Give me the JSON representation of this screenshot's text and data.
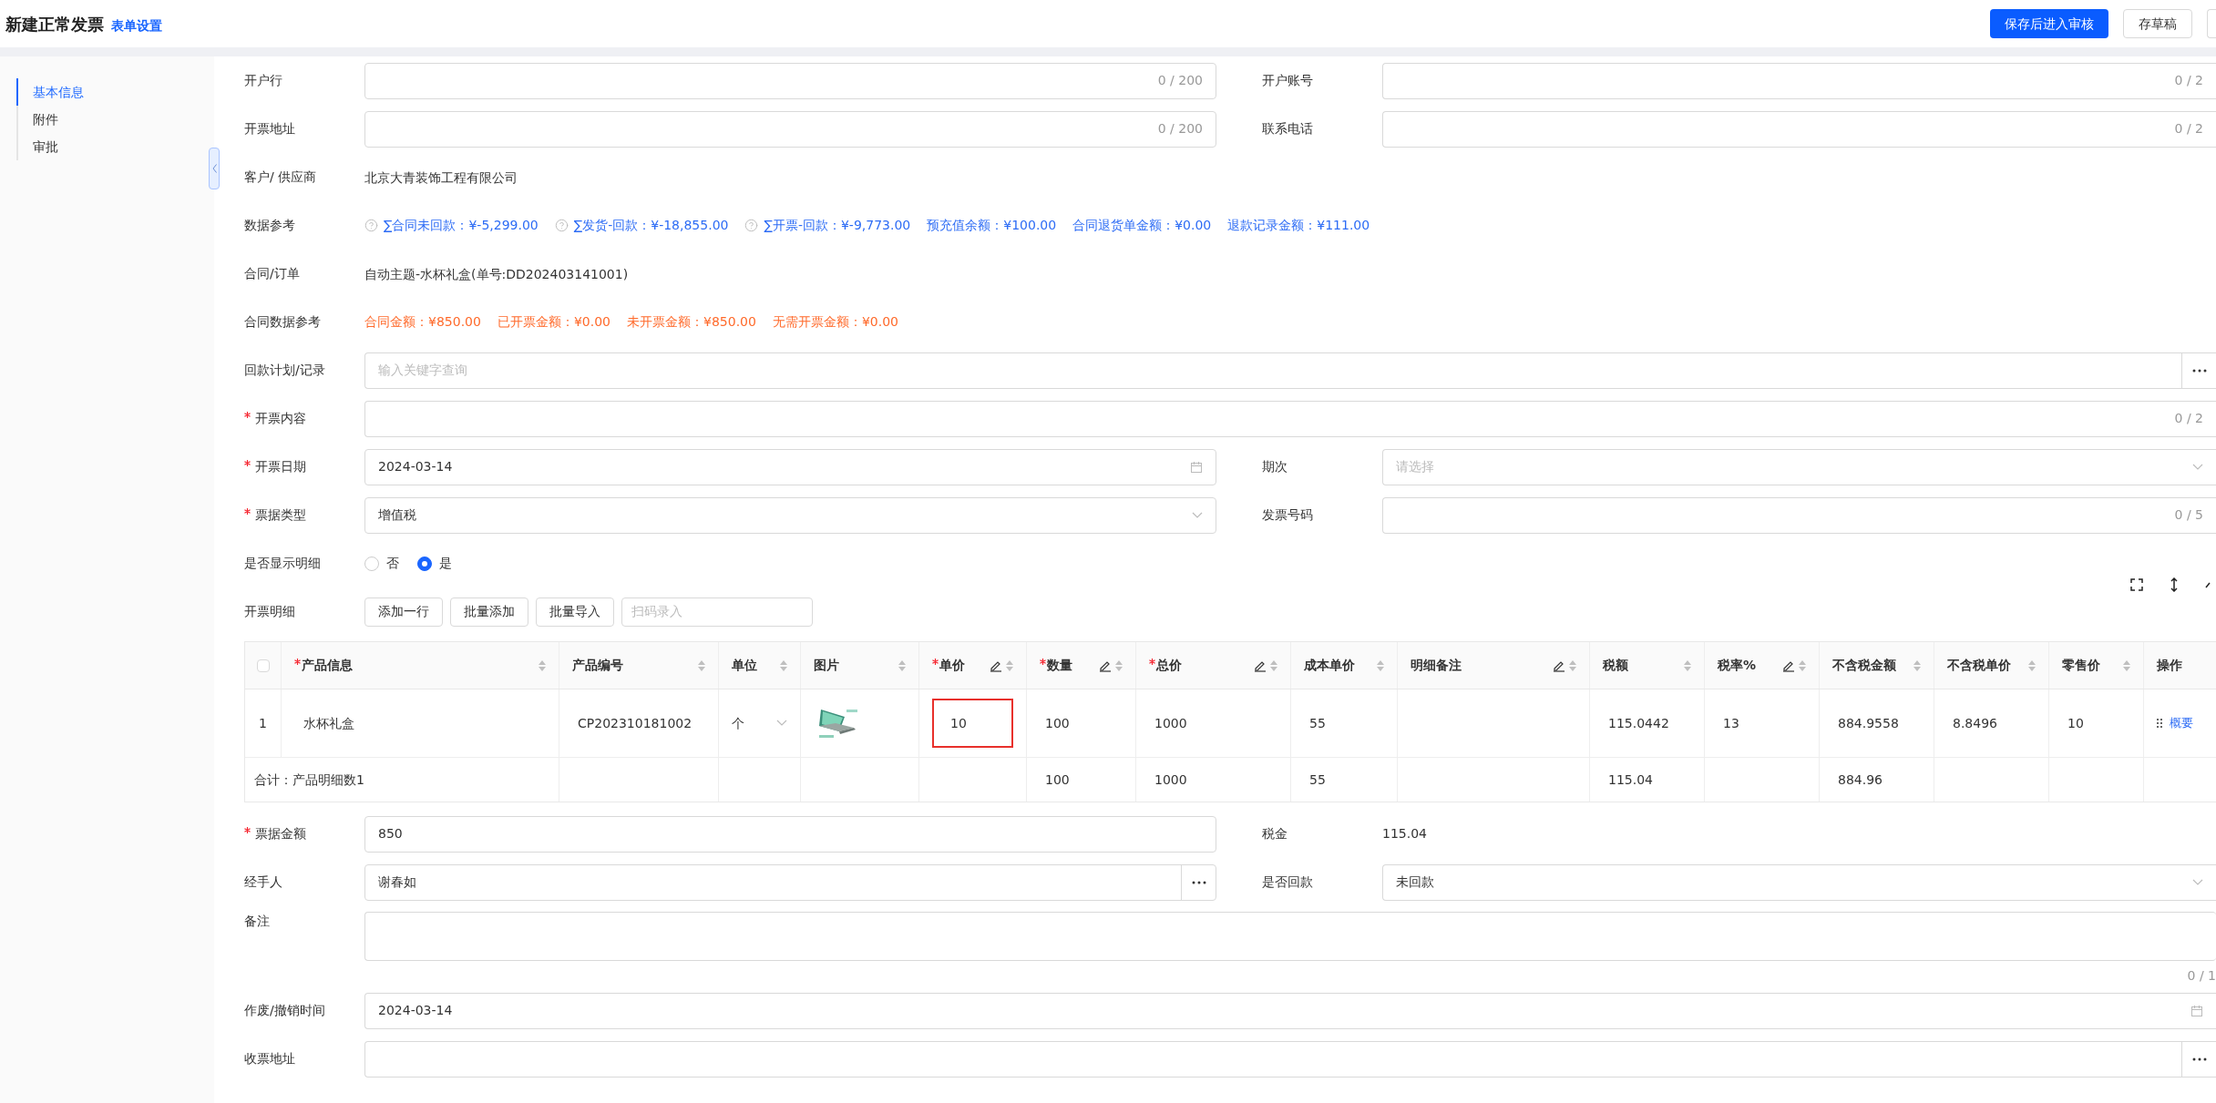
{
  "header": {
    "title": "新建正常发票",
    "link": "表单设置",
    "buttons": [
      {
        "label": "保存后进入审核",
        "kind": "primary"
      },
      {
        "label": "存草稿",
        "kind": "default"
      }
    ]
  },
  "sidebar": {
    "items": [
      {
        "label": "基本信息",
        "selected": true
      },
      {
        "label": "附件",
        "selected": false
      },
      {
        "label": "审批",
        "selected": false
      }
    ]
  },
  "form_top": [
    {
      "left": {
        "label": "开户行",
        "kind": "input",
        "counter": "0 / 200"
      },
      "right": {
        "label": "开户账号",
        "kind": "input",
        "counter": "0 / 2"
      }
    },
    {
      "left": {
        "label": "开票地址",
        "kind": "input",
        "counter": "0 / 200"
      },
      "right": {
        "label": "联系电话",
        "kind": "input",
        "counter": "0 / 2"
      }
    },
    {
      "left": {
        "label": "客户/ 供应商",
        "kind": "text",
        "value": "北京大青装饰工程有限公司"
      }
    },
    {
      "left": {
        "label": "数据参考",
        "kind": "refs",
        "items": [
          {
            "text": "∑合同未回款：¥-5,299.00",
            "help": true,
            "color": "#2d6cf5"
          },
          {
            "text": "∑发货-回款：¥-18,855.00",
            "help": true,
            "color": "#2d6cf5"
          },
          {
            "text": "∑开票-回款：¥-9,773.00",
            "help": true,
            "color": "#2d6cf5"
          },
          {
            "text": "预充值余额：¥100.00",
            "help": false,
            "color": "#2d6cf5"
          },
          {
            "text": "合同退货单金额：¥0.00",
            "help": false,
            "color": "#2d6cf5"
          },
          {
            "text": "退款记录金额：¥111.00",
            "help": false,
            "color": "#2d6cf5"
          }
        ]
      }
    },
    {
      "left": {
        "label": "合同/订单",
        "kind": "text",
        "value": "自动主题-水杯礼盒(单号:DD202403141001)"
      }
    },
    {
      "left": {
        "label": "合同数据参考",
        "kind": "refs",
        "items": [
          {
            "text": "合同金额：¥850.00",
            "help": false,
            "color": "#ff6a2b"
          },
          {
            "text": "已开票金额：¥0.00",
            "help": false,
            "color": "#ff6a2b"
          },
          {
            "text": "未开票金额：¥850.00",
            "help": false,
            "color": "#ff6a2b"
          },
          {
            "text": "无需开票金额：¥0.00",
            "help": false,
            "color": "#ff6a2b"
          }
        ]
      }
    },
    {
      "left": {
        "label": "回款计划/记录",
        "kind": "lookup",
        "placeholder": "输入关键字查询"
      }
    },
    {
      "left": {
        "label": "开票内容",
        "required": true,
        "kind": "input",
        "counter": "0 / 2"
      }
    },
    {
      "left": {
        "label": "开票日期",
        "required": true,
        "kind": "date",
        "value": "2024-03-14"
      },
      "right": {
        "label": "期次",
        "kind": "select",
        "placeholder": "请选择"
      }
    },
    {
      "left": {
        "label": "票据类型",
        "required": true,
        "kind": "select",
        "value": "增值税"
      },
      "right": {
        "label": "发票号码",
        "kind": "input",
        "counter": "0 / 5"
      }
    },
    {
      "left": {
        "label": "是否显示明细",
        "kind": "radio",
        "options": [
          {
            "label": "否",
            "selected": false
          },
          {
            "label": "是",
            "selected": true
          }
        ]
      }
    },
    {
      "left": {
        "label": "开票明细",
        "kind": "buttons",
        "buttons": [
          "添加一行",
          "批量添加",
          "批量导入"
        ],
        "placeholder": "扫码录入"
      }
    }
  ],
  "table": {
    "all_selected": false,
    "columns": [
      {
        "label": "产品信息",
        "kind": "text",
        "required": true,
        "editable": false,
        "sortable": true
      },
      {
        "label": "产品编号",
        "kind": "text",
        "required": false,
        "editable": false,
        "sortable": true
      },
      {
        "label": "单位",
        "kind": "select",
        "required": false,
        "editable": false,
        "sortable": true
      },
      {
        "label": "图片",
        "kind": "picture",
        "required": false,
        "editable": false,
        "sortable": true
      },
      {
        "label": "单价",
        "kind": "price",
        "required": true,
        "editable": true,
        "sortable": true
      },
      {
        "label": "数量",
        "kind": "text",
        "required": true,
        "editable": true,
        "sortable": true
      },
      {
        "label": "总价",
        "kind": "text",
        "required": true,
        "editable": true,
        "sortable": true
      },
      {
        "label": "成本单价",
        "kind": "text",
        "required": false,
        "editable": false,
        "sortable": true
      },
      {
        "label": "明细备注",
        "kind": "text",
        "required": false,
        "editable": true,
        "sortable": true
      },
      {
        "label": "税额",
        "kind": "text",
        "required": false,
        "editable": false,
        "sortable": true
      },
      {
        "label": "税率%",
        "kind": "text",
        "required": false,
        "editable": true,
        "sortable": true
      },
      {
        "label": "不含税金额",
        "kind": "text",
        "required": false,
        "editable": false,
        "sortable": true
      },
      {
        "label": "不含税单价",
        "kind": "text",
        "required": false,
        "editable": false,
        "sortable": true
      },
      {
        "label": "零售价",
        "kind": "text",
        "required": false,
        "editable": false,
        "sortable": true
      },
      {
        "label": "操作",
        "kind": "action",
        "required": false,
        "editable": false,
        "sortable": false
      }
    ],
    "rows": [
      {
        "index": "1",
        "price_highlighted": true,
        "cells": [
          "水杯礼盒",
          "CP202310181002",
          "个",
          "",
          "10",
          "100",
          "1000",
          "55",
          "",
          "115.0442",
          "13",
          "884.9558",
          "8.8496",
          "10",
          "概要"
        ]
      }
    ],
    "total": {
      "label": "合计：产品明细数1",
      "cells": [
        "",
        "",
        "",
        "",
        "",
        "100",
        "1000",
        "55",
        "",
        "115.04",
        "",
        "884.96",
        "",
        "",
        ""
      ]
    }
  },
  "form_bottom": [
    {
      "left": {
        "label": "票据金额",
        "required": true,
        "kind": "input",
        "value": "850"
      },
      "right": {
        "label": "税金",
        "kind": "text",
        "value": "115.04"
      }
    },
    {
      "left": {
        "label": "经手人",
        "kind": "lookup",
        "value": "谢春如"
      },
      "right": {
        "label": "是否回款",
        "kind": "select",
        "value": "未回款"
      }
    },
    {
      "left": {
        "label": "备注",
        "kind": "textarea",
        "counter": "0 / 1"
      }
    },
    {
      "left": {
        "label": "作废/撤销时间",
        "kind": "date",
        "value": "2024-03-14"
      }
    },
    {
      "left": {
        "label": "收票地址",
        "kind": "lookup"
      }
    }
  ]
}
